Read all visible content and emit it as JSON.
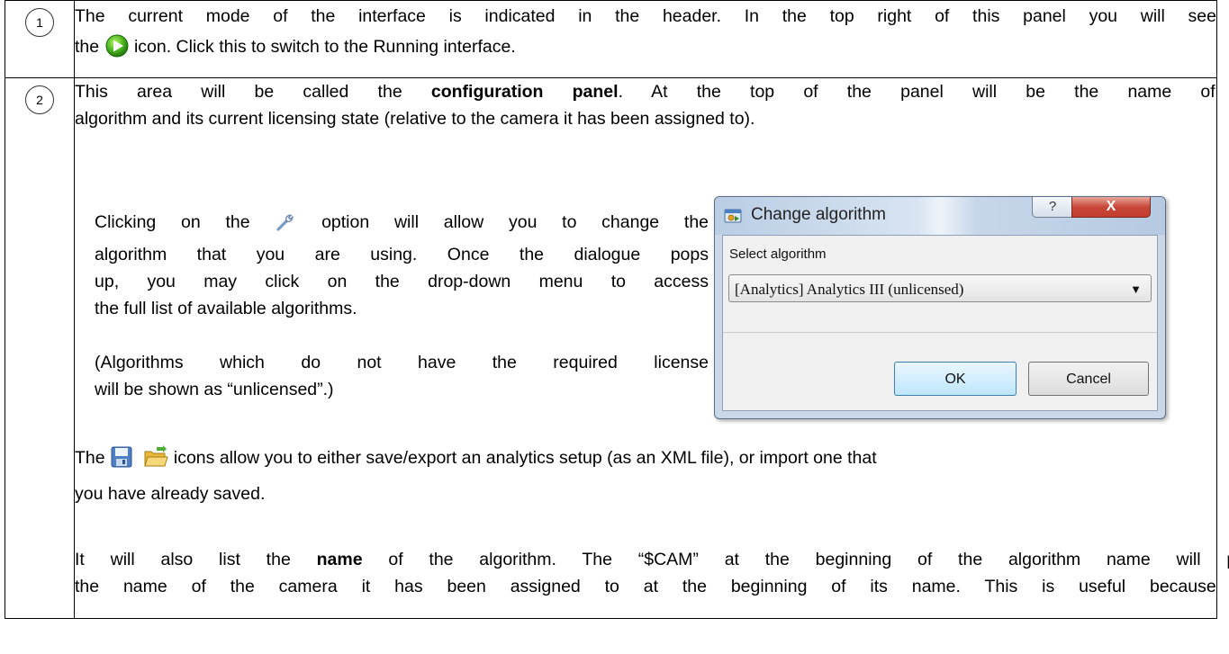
{
  "row1": {
    "number": "1",
    "line1": "The current mode of the interface is indicated in the header. In the top right of this panel you will see",
    "line2_before": "the",
    "line2_after": "icon. Click this to switch to the Running interface.",
    "icon": "play-icon"
  },
  "row2": {
    "number": "2",
    "intro_line1_a": "This area will be called the",
    "intro_bold": "configuration panel",
    "intro_line1_b": ". At the top of the panel will be the name of the",
    "intro_line2": "algorithm and its current licensing state (relative to the camera it has been assigned to).",
    "wrench_line1_a": "Clicking on the",
    "wrench_line1_b": "option will allow you to change the",
    "wrench_line2": "algorithm that you are using. Once the dialogue pops",
    "wrench_line3": "up, you may click on the drop-down menu to access",
    "wrench_line4": "the full list of available algorithms.",
    "unlicensed_line1": "(Algorithms which do not have the required license",
    "unlicensed_line2": "will be shown as “unlicensed”.)",
    "icons_line1_a": "The",
    "icons_line1_b": "icons allow you to either save/export an analytics setup (as an XML file), or import one that",
    "icons_line2": "you have already saved.",
    "name_line1_a": "It will also list the",
    "name_bold": "name",
    "name_line1_b": "of the algorithm. The “$CAM” at the beginning of the algorithm name will place",
    "name_line2": "the name of the camera it has been assigned to at the beginning of its name. This is useful because you"
  },
  "dialog": {
    "title": "Change algorithm",
    "help_label": "?",
    "close_label": "X",
    "select_label": "Select algorithm",
    "selected_value": "[Analytics] Analytics III (unlicensed)",
    "ok_label": "OK",
    "cancel_label": "Cancel"
  }
}
